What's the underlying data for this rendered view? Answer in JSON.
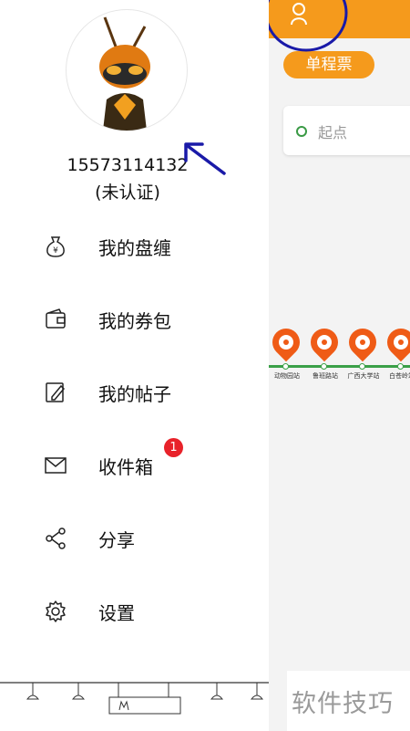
{
  "drawer": {
    "phone": "15573114132",
    "verify_status": "(未认证)",
    "menu": [
      {
        "label": "我的盘缠",
        "icon": "money-bag-icon"
      },
      {
        "label": "我的券包",
        "icon": "wallet-icon"
      },
      {
        "label": "我的帖子",
        "icon": "post-edit-icon"
      },
      {
        "label": "收件箱",
        "icon": "mail-icon",
        "badge": "1"
      },
      {
        "label": "分享",
        "icon": "share-icon"
      },
      {
        "label": "设置",
        "icon": "gear-icon"
      }
    ]
  },
  "main": {
    "ticket_tab": "单程票",
    "start_placeholder": "起点",
    "stations": [
      "动物园站",
      "鲁班路站",
      "广西大学站",
      "白苍岭站"
    ]
  },
  "watermark": "软件技巧",
  "colors": {
    "accent": "#f59a1c",
    "pin": "#ef5b16",
    "route": "#3aa048",
    "badge": "#e8222a",
    "annotation": "#1a1aa8"
  }
}
